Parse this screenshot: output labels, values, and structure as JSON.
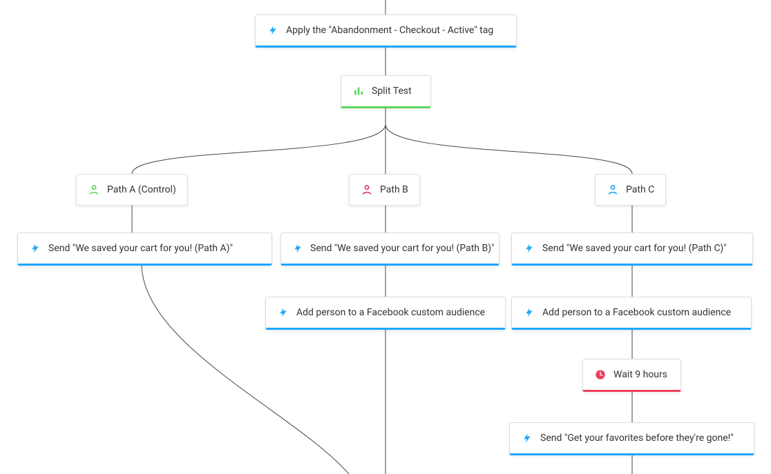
{
  "nodes": {
    "apply_tag": {
      "label": "Apply the \"Abandonment - Checkout - Active\" tag"
    },
    "split_test": {
      "label": "Split Test"
    },
    "path_a": {
      "label": "Path A (Control)"
    },
    "path_b": {
      "label": "Path B"
    },
    "path_c": {
      "label": "Path C"
    },
    "send_a": {
      "label": "Send \"We saved your cart for you! (Path A)\""
    },
    "send_b": {
      "label": "Send \"We saved your cart for you! (Path B)\""
    },
    "send_c": {
      "label": "Send \"We saved your cart for you! (Path C)\""
    },
    "fb_b": {
      "label": "Add person to a Facebook custom audience"
    },
    "fb_c": {
      "label": "Add person to a Facebook custom audience"
    },
    "wait_c": {
      "label": "Wait 9 hours"
    },
    "send_c2": {
      "label": "Send \"Get your favorites before they're gone!\""
    }
  },
  "colors": {
    "blue": "#1ea7fd",
    "green": "#5cd65c",
    "magenta": "#d63384",
    "red": "#ef3e5b",
    "line": "#444444"
  }
}
